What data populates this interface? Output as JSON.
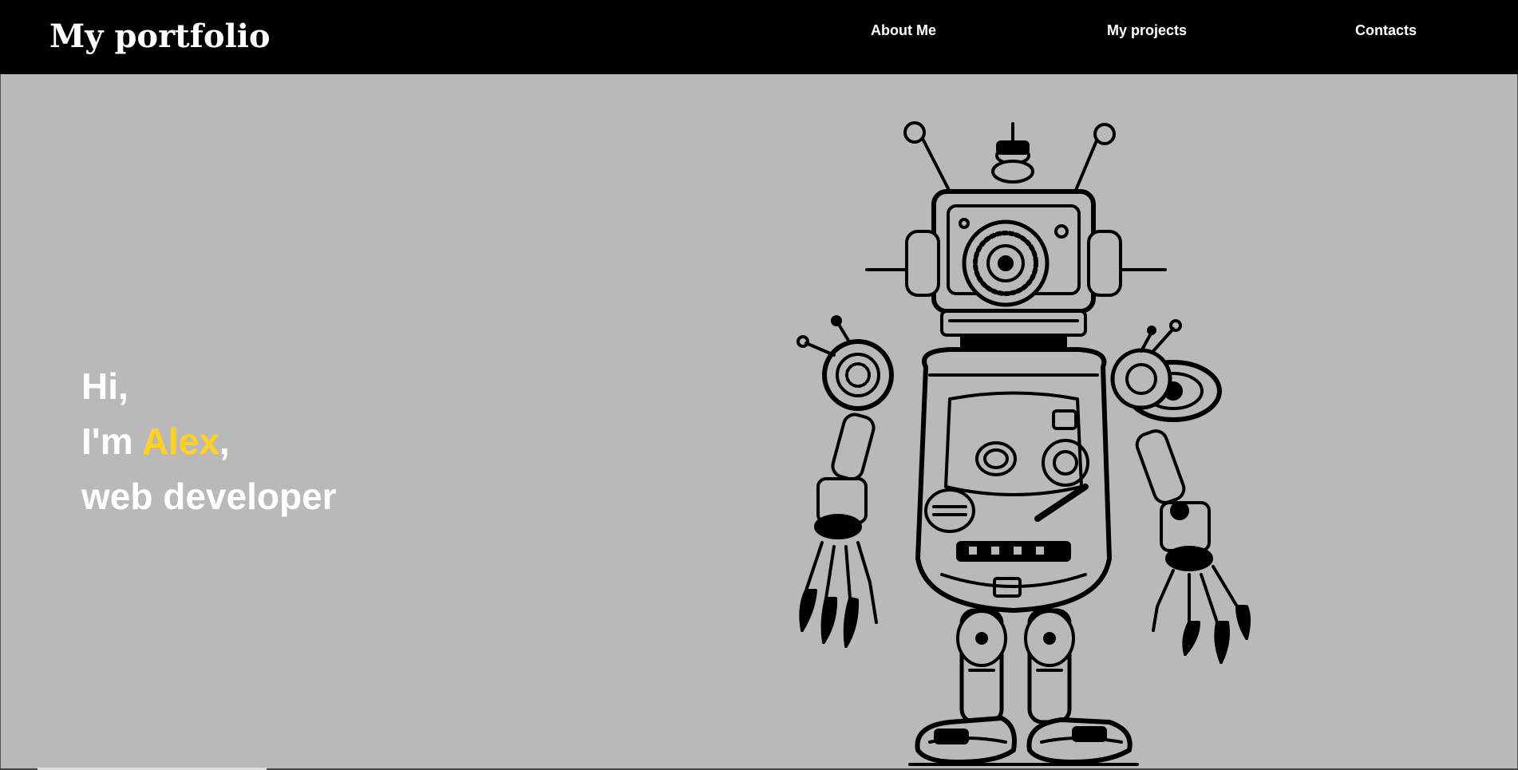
{
  "header": {
    "logo": "My portfolio",
    "nav": {
      "about": "About Me",
      "projects": "My projects",
      "contacts": "Contacts"
    }
  },
  "hero": {
    "greeting": "Hi,",
    "intro_prefix": "I'm ",
    "name": "Alex",
    "intro_suffix": ",",
    "role": "web developer"
  },
  "colors": {
    "header_bg": "#000000",
    "page_bg": "#b9b9b9",
    "text": "#ffffff",
    "accent": "#ffd21f"
  },
  "illustration": "robot-illustration"
}
